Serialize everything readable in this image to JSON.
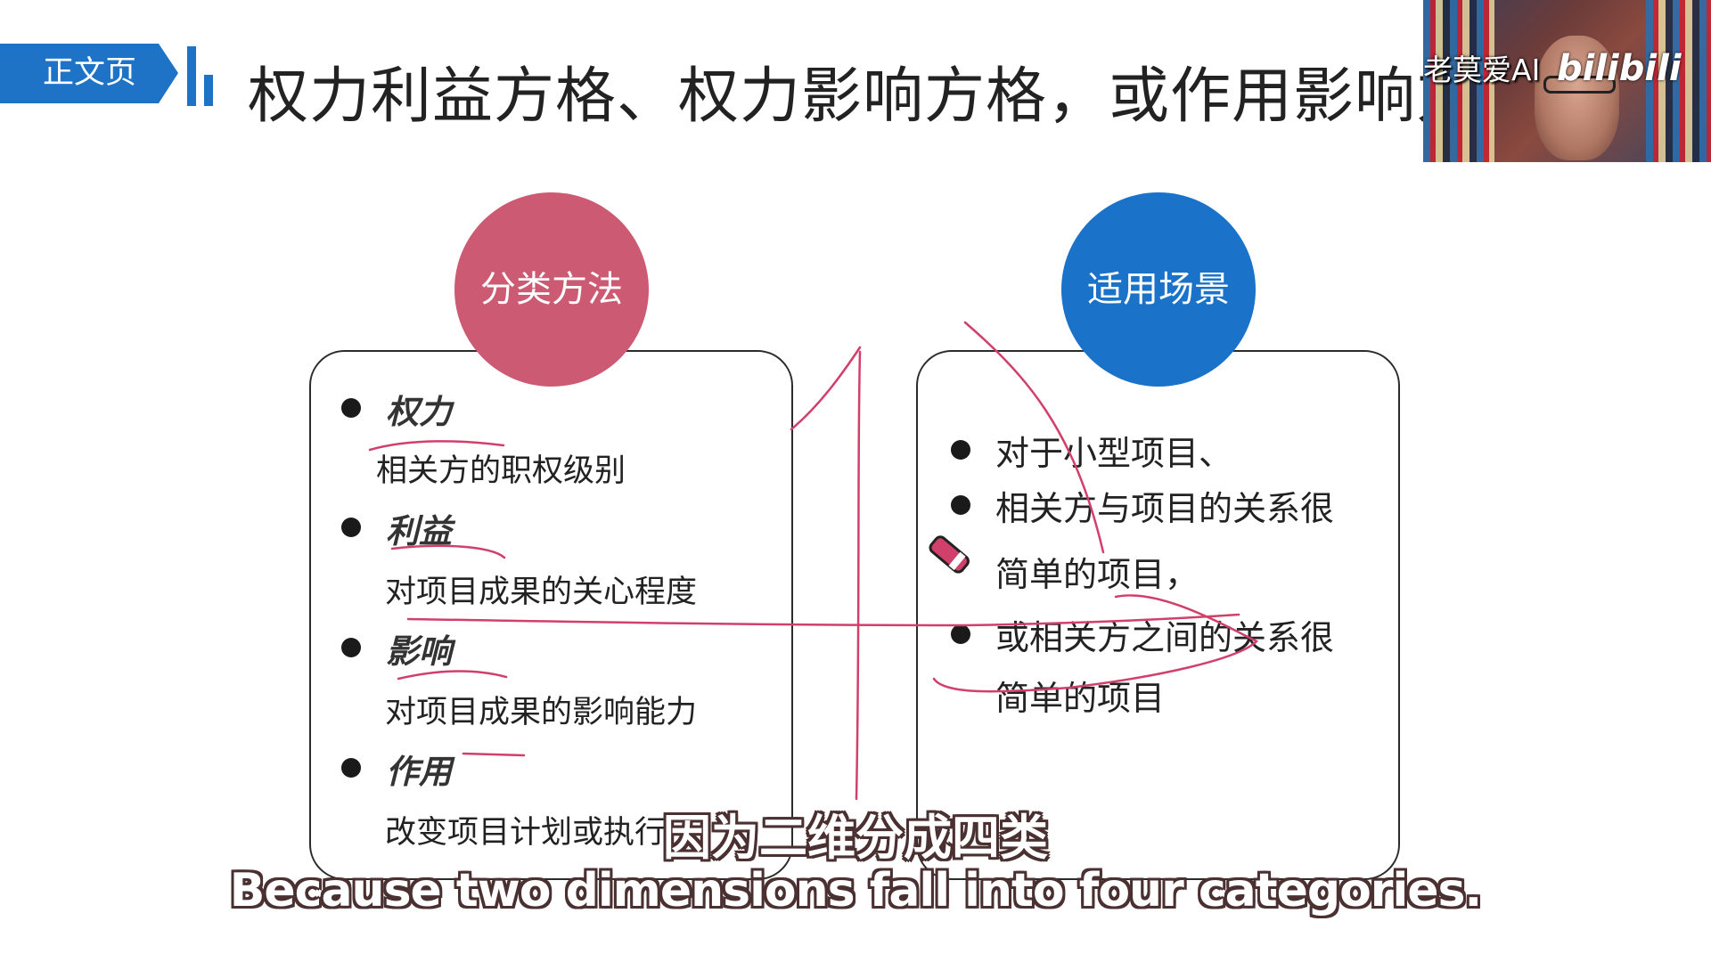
{
  "header": {
    "tag_label": "正文页",
    "title": "权力利益方格、权力影响方格，或作用影响方格"
  },
  "webcam": {
    "channel_name": "老莫爱AI",
    "platform_logo": "bilibili"
  },
  "left_card": {
    "heading": "分类方法",
    "items": [
      {
        "title": "权力",
        "desc": "相关方的职权级别"
      },
      {
        "title": "利益",
        "desc": "对项目成果的关心程度"
      },
      {
        "title": "影响",
        "desc": "对项目成果的影响能力"
      },
      {
        "title": "作用",
        "desc": "改变项目计划或执行"
      }
    ]
  },
  "right_card": {
    "heading": "适用场景",
    "lines": [
      "对于小型项目、",
      "相关方与项目的关系很",
      "简单的项目，",
      "或相关方之间的关系很",
      "简单的项目"
    ]
  },
  "subtitles": {
    "chinese": "因为二维分成四类",
    "english": "Because two dimensions fall into four categories."
  },
  "colors": {
    "accent_blue": "#1f73c6",
    "pink": "#cc5a72",
    "circle_blue": "#1a72c9",
    "annotation": "#d0406a"
  }
}
